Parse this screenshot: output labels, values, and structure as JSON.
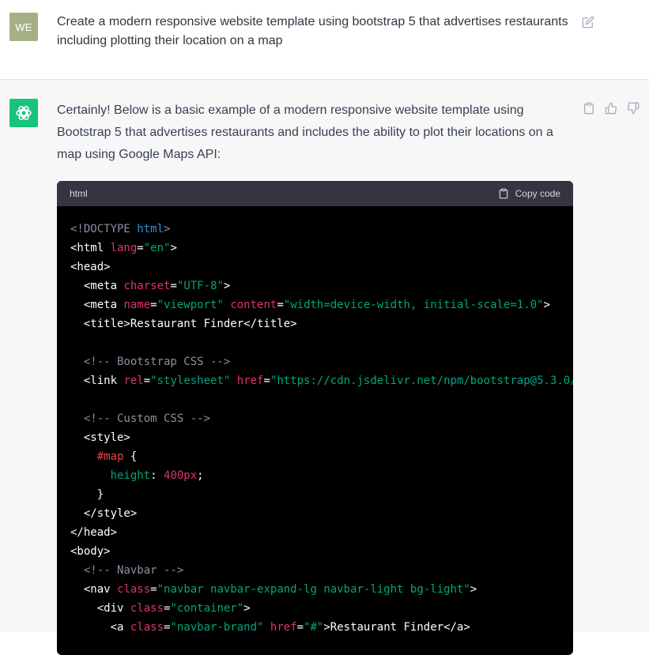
{
  "user_message": {
    "avatar_initials": "WE",
    "text": "Create a modern responsive website template using bootstrap 5 that advertises restaurants including plotting their location on a map"
  },
  "assistant_message": {
    "text": "Certainly! Below is a basic example of a modern responsive website template using Bootstrap 5 that advertises restaurants and includes the ability to plot their locations on a map using Google Maps API:",
    "code_block": {
      "language": "html",
      "copy_label": "Copy code",
      "lines": [
        [
          {
            "t": "<!DOCTYPE ",
            "c": "com"
          },
          {
            "t": "html",
            "c": "kw"
          },
          {
            "t": ">",
            "c": "com"
          }
        ],
        [
          {
            "t": "<html ",
            "c": "tag"
          },
          {
            "t": "lang",
            "c": "attr"
          },
          {
            "t": "=",
            "c": "pun"
          },
          {
            "t": "\"en\"",
            "c": "str"
          },
          {
            "t": ">",
            "c": "tag"
          }
        ],
        [
          {
            "t": "<head>",
            "c": "tag"
          }
        ],
        [
          {
            "t": "  <meta ",
            "c": "tag"
          },
          {
            "t": "charset",
            "c": "attr"
          },
          {
            "t": "=",
            "c": "pun"
          },
          {
            "t": "\"UTF-8\"",
            "c": "str"
          },
          {
            "t": ">",
            "c": "tag"
          }
        ],
        [
          {
            "t": "  <meta ",
            "c": "tag"
          },
          {
            "t": "name",
            "c": "attr"
          },
          {
            "t": "=",
            "c": "pun"
          },
          {
            "t": "\"viewport\"",
            "c": "str"
          },
          {
            "t": " ",
            "c": "pun"
          },
          {
            "t": "content",
            "c": "attr"
          },
          {
            "t": "=",
            "c": "pun"
          },
          {
            "t": "\"width=device-width, initial-scale=1.0\"",
            "c": "str"
          },
          {
            "t": ">",
            "c": "tag"
          }
        ],
        [
          {
            "t": "  <title>Restaurant Finder</title>",
            "c": "tag"
          }
        ],
        [
          {
            "t": "",
            "c": "pun"
          }
        ],
        [
          {
            "t": "  <!-- Bootstrap CSS -->",
            "c": "com"
          }
        ],
        [
          {
            "t": "  <link ",
            "c": "tag"
          },
          {
            "t": "rel",
            "c": "attr"
          },
          {
            "t": "=",
            "c": "pun"
          },
          {
            "t": "\"stylesheet\"",
            "c": "str"
          },
          {
            "t": " ",
            "c": "pun"
          },
          {
            "t": "href",
            "c": "attr"
          },
          {
            "t": "=",
            "c": "pun"
          },
          {
            "t": "\"https://cdn.jsdelivr.net/npm/bootstrap@5.3.0/",
            "c": "str"
          }
        ],
        [
          {
            "t": "",
            "c": "pun"
          }
        ],
        [
          {
            "t": "  <!-- Custom CSS -->",
            "c": "com"
          }
        ],
        [
          {
            "t": "  <style>",
            "c": "tag"
          }
        ],
        [
          {
            "t": "    ",
            "c": "pun"
          },
          {
            "t": "#map",
            "c": "sel"
          },
          {
            "t": " {",
            "c": "pun"
          }
        ],
        [
          {
            "t": "      ",
            "c": "pun"
          },
          {
            "t": "height",
            "c": "prop"
          },
          {
            "t": ": ",
            "c": "pun"
          },
          {
            "t": "400px",
            "c": "num"
          },
          {
            "t": ";",
            "c": "pun"
          }
        ],
        [
          {
            "t": "    }",
            "c": "pun"
          }
        ],
        [
          {
            "t": "  </style>",
            "c": "tag"
          }
        ],
        [
          {
            "t": "</head>",
            "c": "tag"
          }
        ],
        [
          {
            "t": "<body>",
            "c": "tag"
          }
        ],
        [
          {
            "t": "  <!-- Navbar -->",
            "c": "com"
          }
        ],
        [
          {
            "t": "  <nav ",
            "c": "tag"
          },
          {
            "t": "class",
            "c": "attr"
          },
          {
            "t": "=",
            "c": "pun"
          },
          {
            "t": "\"navbar navbar-expand-lg navbar-light bg-light\"",
            "c": "str"
          },
          {
            "t": ">",
            "c": "tag"
          }
        ],
        [
          {
            "t": "    <div ",
            "c": "tag"
          },
          {
            "t": "class",
            "c": "attr"
          },
          {
            "t": "=",
            "c": "pun"
          },
          {
            "t": "\"container\"",
            "c": "str"
          },
          {
            "t": ">",
            "c": "tag"
          }
        ],
        [
          {
            "t": "      <a ",
            "c": "tag"
          },
          {
            "t": "class",
            "c": "attr"
          },
          {
            "t": "=",
            "c": "pun"
          },
          {
            "t": "\"navbar-brand\"",
            "c": "str"
          },
          {
            "t": " ",
            "c": "pun"
          },
          {
            "t": "href",
            "c": "attr"
          },
          {
            "t": "=",
            "c": "pun"
          },
          {
            "t": "\"#\"",
            "c": "str"
          },
          {
            "t": ">Restaurant Finder</a>",
            "c": "tag"
          }
        ]
      ]
    }
  },
  "icons": {
    "edit": "edit-icon",
    "copy_message": "clipboard-icon",
    "thumbs_up": "thumbs-up-icon",
    "thumbs_down": "thumbs-down-icon",
    "copy_code": "clipboard-icon",
    "assistant_logo": "openai-logo-icon"
  },
  "colors": {
    "user_avatar_bg": "#a5b185",
    "assistant_avatar_bg": "#19c37d",
    "assistant_row_bg": "#f7f7f8",
    "code_bg": "#000000",
    "code_header_bg": "#343541"
  }
}
